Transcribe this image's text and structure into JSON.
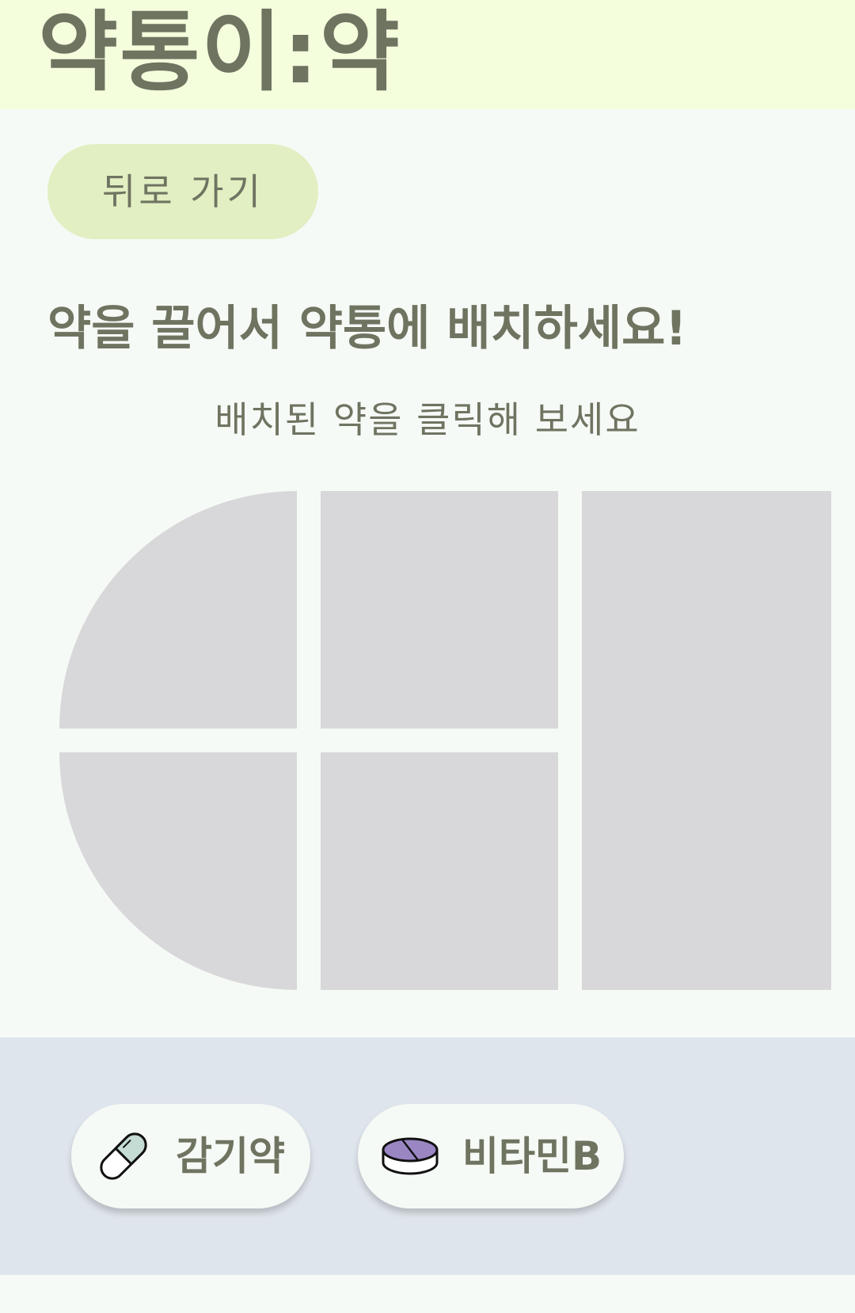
{
  "header": {
    "title": "약통이:약"
  },
  "nav": {
    "back_label": "뒤로 가기"
  },
  "instructions": {
    "title": "약을 끌어서 약통에 배치하세요!",
    "subtitle": "배치된 약을 클릭해 보세요"
  },
  "tray": {
    "pills": [
      {
        "label": "감기약",
        "icon": "capsule-icon",
        "color": "#c5dcd4"
      },
      {
        "label": "비타민B",
        "icon": "tablet-icon",
        "color": "#9b86c4"
      }
    ]
  },
  "colors": {
    "header_bg": "#f4fedd",
    "accent_button": "#e1efc2",
    "text": "#6f7461",
    "compartment": "#d8d7d9",
    "tray_bg": "#dfe5ec"
  }
}
